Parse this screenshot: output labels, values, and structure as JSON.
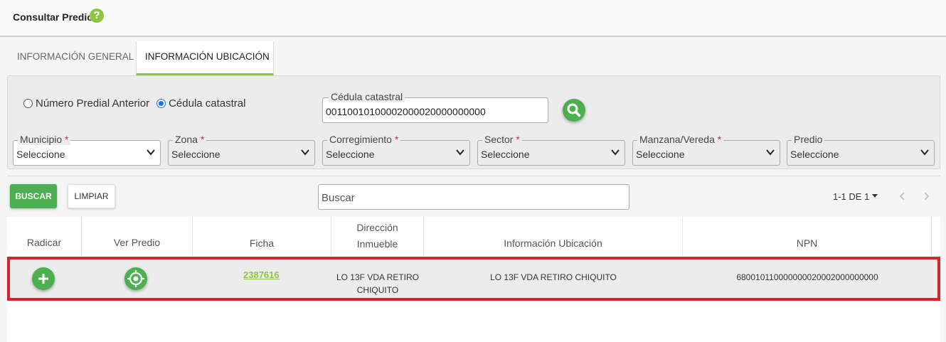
{
  "header": {
    "title": "Consultar Predio",
    "help_glyph": "?"
  },
  "tabs": [
    {
      "label": "INFORMACIÓN GENERAL",
      "active": false
    },
    {
      "label": "INFORMACIÓN UBICACIÓN",
      "active": true
    }
  ],
  "search_mode": {
    "options": [
      {
        "label": "Número Predial Anterior",
        "selected": false
      },
      {
        "label": "Cédula catastral",
        "selected": true
      }
    ]
  },
  "cedula": {
    "label": "Cédula catastral",
    "value": "00110010100002000020000000000"
  },
  "filters": [
    {
      "label": "Municipio",
      "required_mark": "*",
      "value": "Seleccione"
    },
    {
      "label": "Zona",
      "required_mark": "*",
      "value": "Seleccione"
    },
    {
      "label": "Corregimiento",
      "required_mark": "*",
      "value": "Seleccione"
    },
    {
      "label": "Sector",
      "required_mark": "*",
      "value": "Seleccione"
    },
    {
      "label": "Manzana/Vereda",
      "required_mark": "*",
      "value": "Seleccione"
    },
    {
      "label": "Predio",
      "required_mark": "",
      "value": "Seleccione"
    }
  ],
  "actions": {
    "buscar": "BUSCAR",
    "limpiar": "LIMPIAR"
  },
  "table_search": {
    "placeholder": "Buscar"
  },
  "pagination": {
    "label": "1-1 DE 1"
  },
  "table": {
    "headers": [
      "Radicar",
      "Ver Predio",
      "Ficha",
      "Dirección Inmueble",
      "Información Ubicación",
      "NPN"
    ],
    "rows": [
      {
        "ficha": "2387616",
        "direccion": "LO 13F VDA RETIRO CHIQUITO",
        "ubicacion": "LO 13F VDA RETIRO CHIQUITO",
        "npn": "680010110000000020002000000000"
      }
    ]
  },
  "colors": {
    "accent_green": "#4caf50",
    "lime": "#8cc63f",
    "highlight_red": "#d7232e"
  },
  "icons": {
    "radicar": "plus-icon",
    "ver_predio": "crosshair-icon",
    "search": "search-icon"
  }
}
